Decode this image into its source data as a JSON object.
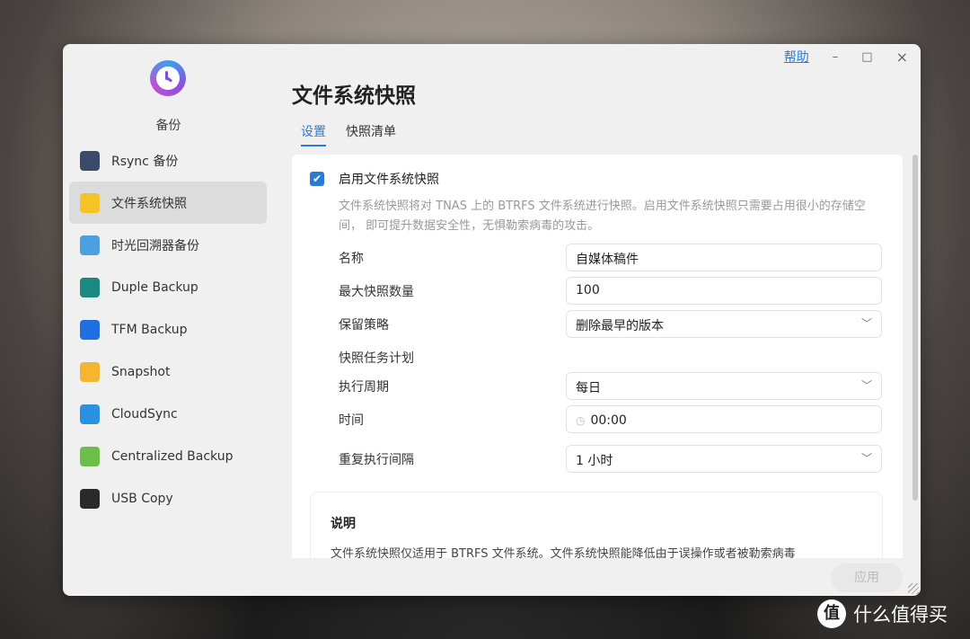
{
  "window": {
    "help": "帮助",
    "minimize": "–",
    "maximize": "□",
    "close": "×"
  },
  "sidebar": {
    "app_name": "备份",
    "items": [
      {
        "label": "Rsync 备份",
        "icon": "server-globe-icon",
        "color": "#3b4a6b"
      },
      {
        "label": "文件系统快照",
        "icon": "folder-snapshot-icon",
        "color": "#f5c227",
        "active": true
      },
      {
        "label": "时光回溯器备份",
        "icon": "time-machine-icon",
        "color": "#4aa0e0"
      },
      {
        "label": "Duple Backup",
        "icon": "duple-backup-icon",
        "color": "#1a8a80"
      },
      {
        "label": "TFM Backup",
        "icon": "tfm-book-icon",
        "color": "#1f6fe0"
      },
      {
        "label": "Snapshot",
        "icon": "folder-camera-icon",
        "color": "#f5b530"
      },
      {
        "label": "CloudSync",
        "icon": "cloud-icon",
        "color": "#2a90e0"
      },
      {
        "label": "Centralized Backup",
        "icon": "network-nodes-icon",
        "color": "#6cc04a"
      },
      {
        "label": "USB Copy",
        "icon": "usb-icon",
        "color": "#2a2a2a"
      }
    ]
  },
  "main": {
    "title": "文件系统快照",
    "tabs": [
      {
        "label": "设置",
        "active": true
      },
      {
        "label": "快照清单"
      }
    ],
    "enable_label": "启用文件系统快照",
    "enabled": true,
    "description": "文件系统快照将对 TNAS 上的 BTRFS 文件系统进行快照。启用文件系统快照只需要占用很小的存储空间， 即可提升数据安全性，无惧勒索病毒的攻击。",
    "fields": {
      "name_label": "名称",
      "name_value": "自媒体稿件",
      "max_label": "最大快照数量",
      "max_value": "100",
      "policy_label": "保留策略",
      "policy_value": "删除最早的版本",
      "schedule_heading": "快照任务计划",
      "period_label": "执行周期",
      "period_value": "每日",
      "time_label": "时间",
      "time_value": "00:00",
      "interval_label": "重复执行间隔",
      "interval_value": "1 小时"
    },
    "note": {
      "title": "说明",
      "text": "文件系统快照仅适用于 BTRFS 文件系统。文件系统快照能降低由于误操作或者被勒索病毒"
    },
    "apply_label": "应用"
  },
  "watermark": {
    "logo": "值",
    "text": "什么值得买"
  },
  "colors": {
    "accent": "#2a7ad6"
  }
}
